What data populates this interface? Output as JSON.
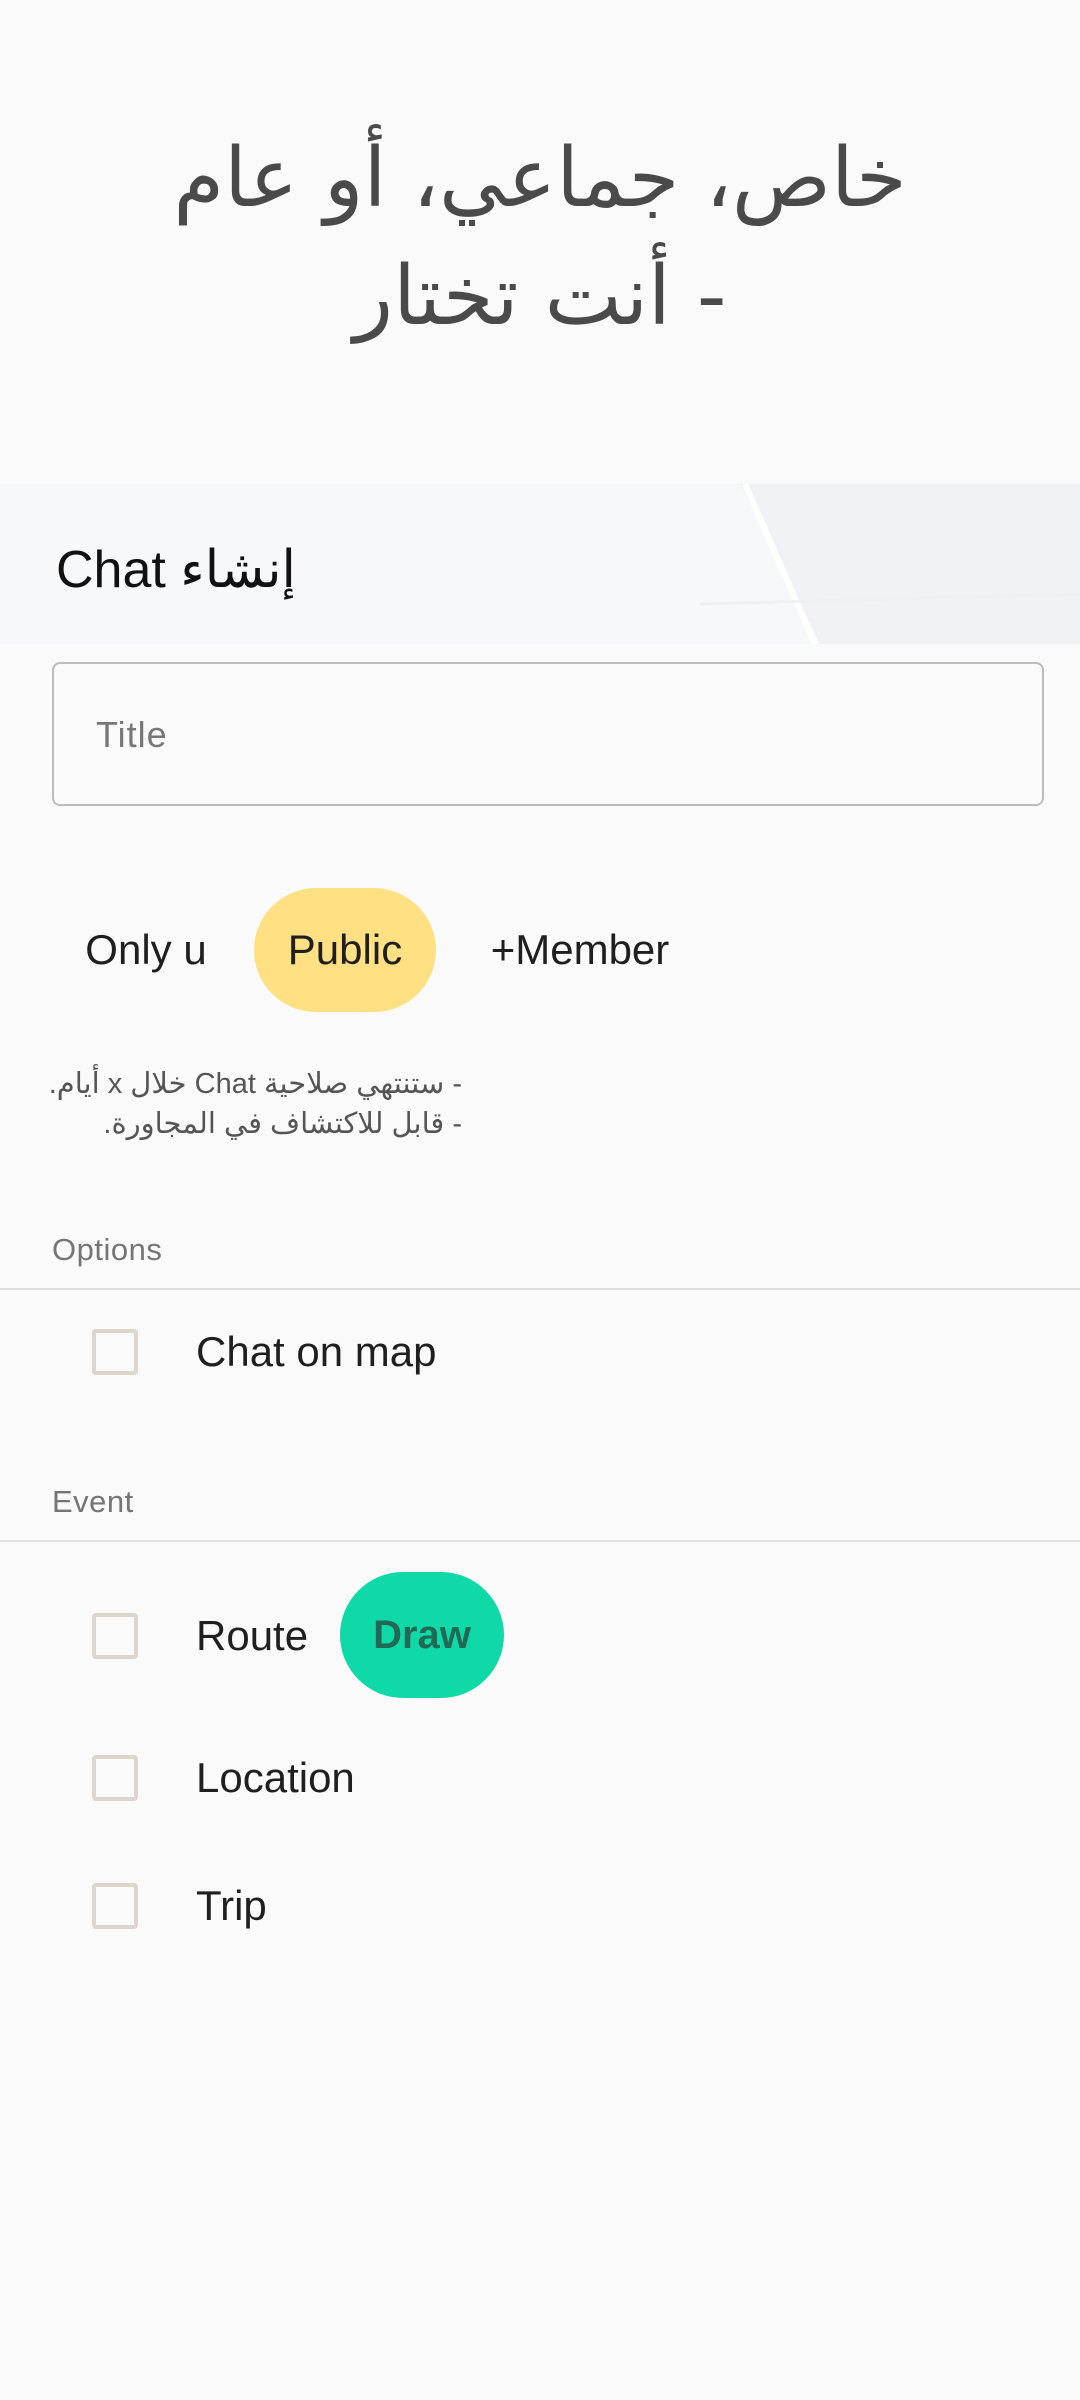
{
  "hero": {
    "line1": "خاص، جماعي، أو عام",
    "line2": "- أنت تختار"
  },
  "create": {
    "heading_ltr": "Chat",
    "heading_ar": "إنشاء",
    "title_placeholder": "Title"
  },
  "visibility": {
    "options": [
      "Only u",
      "Public",
      "+Member"
    ],
    "selected": "Public",
    "selected_color": "#ffe082"
  },
  "notes": {
    "line1": "- ستنتهي صلاحية Chat خلال x أيام.",
    "line2": "- قابل للاكتشاف في المجاورة."
  },
  "options_section": {
    "label": "Options",
    "items": [
      {
        "label": "Chat on map",
        "checked": false
      }
    ]
  },
  "event_section": {
    "label": "Event",
    "items": [
      {
        "label": "Route",
        "checked": false
      },
      {
        "label": "Location",
        "checked": false
      },
      {
        "label": "Trip",
        "checked": false
      }
    ],
    "draw_label": "Draw",
    "draw_color": "#10d9a8"
  }
}
